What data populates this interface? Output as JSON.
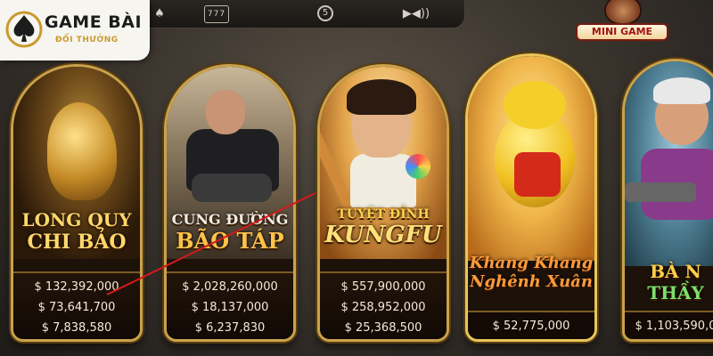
{
  "logo": {
    "title": "GAME BÀI",
    "subtitle": "ĐỔI THƯỞNG"
  },
  "topbar": {
    "icons": [
      "cards-icon",
      "slot-777-icon",
      "chip-5-icon",
      "video-sound-icon"
    ],
    "slot_text": "777",
    "chip_text": "5"
  },
  "mini_game": {
    "label": "MINI GAME"
  },
  "games": [
    {
      "title_line1": "LONG QUY",
      "title_line2": "CHI BẢO",
      "jackpots": [
        "$ 132,392,000",
        "$ 73,641,700",
        "$ 7,838,580"
      ]
    },
    {
      "title_line1": "CUNG ĐƯỜNG",
      "title_line2": "BÃO TÁP",
      "jackpots": [
        "$ 2,028,260,000",
        "$ 18,137,000",
        "$ 6,237,830"
      ]
    },
    {
      "title_line1": "TUYỆT ĐỈNH",
      "title_line2": "KUNGFU",
      "jackpots": [
        "$ 557,900,000",
        "$ 258,952,000",
        "$ 25,368,500"
      ]
    },
    {
      "title_line1": "Khang Khang",
      "title_line2": "Nghênh Xuân",
      "jackpots": [
        "$ 52,775,000"
      ]
    },
    {
      "title_line1": "BÀ N",
      "title_line2": "THẦY",
      "jackpots": [
        "$ 1,103,590,0"
      ]
    }
  ],
  "colors": {
    "accent_gold": "#c9a24a",
    "annotation_red": "#d21a1a"
  }
}
